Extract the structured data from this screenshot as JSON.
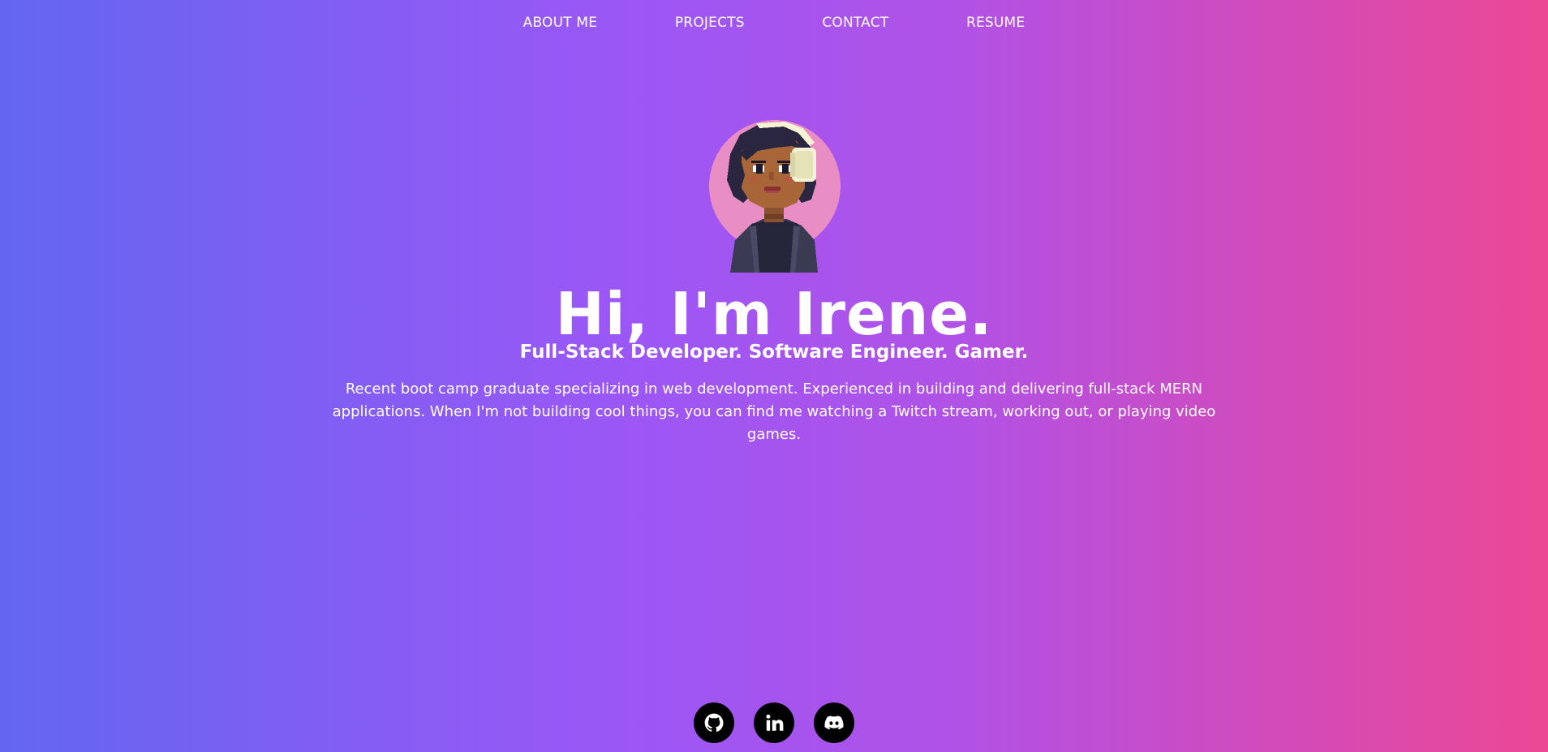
{
  "nav": {
    "items": [
      {
        "label": "ABOUT ME"
      },
      {
        "label": "PROJECTS"
      },
      {
        "label": "CONTACT"
      },
      {
        "label": "RESUME"
      }
    ]
  },
  "hero": {
    "title": "Hi, I'm Irene.",
    "subtitle": "Full-Stack Developer. Software Engineer. Gamer.",
    "description": "Recent boot camp graduate specializing in web development. Experienced in building and delivering full-stack MERN applications. When I'm not building cool things, you can find me watching a Twitch stream, working out, or playing video games."
  },
  "avatar": {
    "icon": "pixel-avatar-with-headphones"
  },
  "socials": [
    {
      "icon": "github-icon"
    },
    {
      "icon": "linkedin-icon"
    },
    {
      "icon": "discord-icon"
    }
  ],
  "colors": {
    "gradient_start": "#6366f1",
    "gradient_mid": "#9b57f6",
    "gradient_end": "#ec4895",
    "avatar_bg": "#e98ec4",
    "social_bg": "#000000"
  }
}
